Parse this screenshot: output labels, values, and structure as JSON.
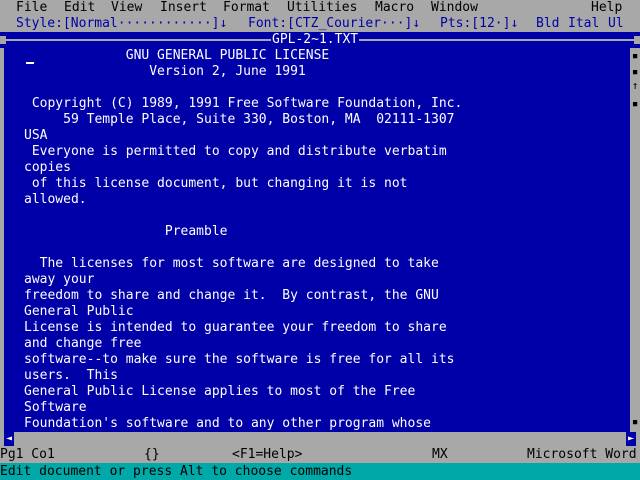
{
  "menu": {
    "items": [
      "File",
      "Edit",
      "View",
      "Insert",
      "Format",
      "Utilities",
      "Macro",
      "Window"
    ],
    "help": "Help"
  },
  "stylebar": {
    "style": "Style:[Normal············]↓",
    "font": "Font:[CTZ_Courier···]↓",
    "points": "Pts:[12·]↓",
    "bold": "Bld",
    "italic": "Ital",
    "underline": "Ul"
  },
  "window": {
    "title": "GPL-2~1.TXT"
  },
  "document": {
    "lines": [
      "             GNU GENERAL PUBLIC LICENSE",
      "                Version 2, June 1991",
      "",
      " Copyright (C) 1989, 1991 Free Software Foundation, Inc.",
      "     59 Temple Place, Suite 330, Boston, MA  02111-1307",
      "USA",
      " Everyone is permitted to copy and distribute verbatim",
      "copies",
      " of this license document, but changing it is not",
      "allowed.",
      "",
      "                  Preamble",
      "",
      "  The licenses for most software are designed to take",
      "away your",
      "freedom to share and change it.  By contrast, the GNU",
      "General Public",
      "License is intended to guarantee your freedom to share",
      "and change free",
      "software--to make sure the software is free for all its",
      "users.  This",
      "General Public License applies to most of the Free",
      "Software",
      "Foundation's software and to any other program whose"
    ]
  },
  "status": {
    "position": "Pg1 Co1",
    "braces": "{}",
    "help": "<F1=Help>",
    "mode": "MX",
    "app": "Microsoft Word"
  },
  "message": "Edit document or press Alt to choose commands",
  "colors": {
    "document_bg": "#0000a8",
    "bar_gray": "#a8a8a8",
    "message_bg": "#00a8a8"
  }
}
